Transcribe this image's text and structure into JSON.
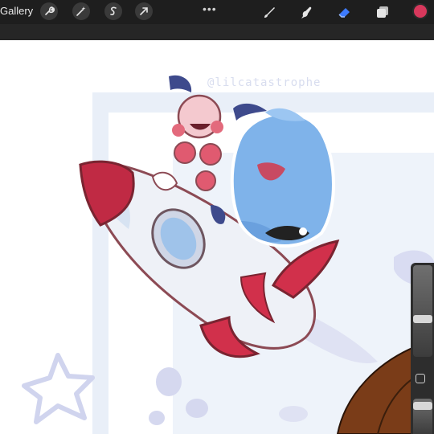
{
  "toolbar": {
    "gallery_label": "Gallery",
    "actions": [
      {
        "name": "wrench-icon"
      },
      {
        "name": "magic-wand-icon"
      },
      {
        "name": "selection-icon"
      },
      {
        "name": "transform-arrow-icon"
      }
    ],
    "more_label": "•••",
    "tools": [
      {
        "name": "brush-icon"
      },
      {
        "name": "smudge-icon"
      },
      {
        "name": "eraser-icon",
        "active": true,
        "color": "#3d7bff"
      },
      {
        "name": "layers-icon"
      }
    ],
    "color_swatch": "#d8385c"
  },
  "canvas": {
    "watermark": "@lilcatastrophe"
  },
  "sidebar": {
    "brush_size": 0.55,
    "opacity": 0.9,
    "modify_button": "modify-square"
  }
}
